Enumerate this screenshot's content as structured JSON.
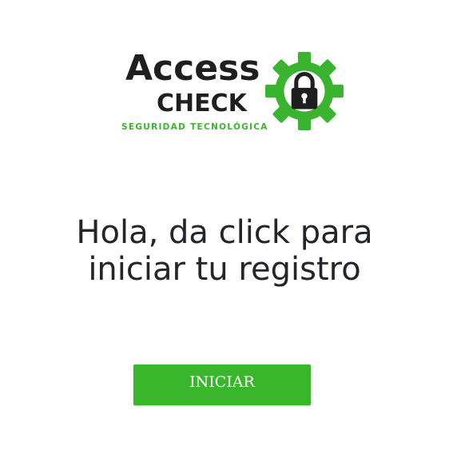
{
  "logo": {
    "title": "Access",
    "subtitle": "CHECK",
    "tagline": "SEGURIDAD TECNOLÓGICA",
    "icon": "gear-lock-icon",
    "colors": {
      "text": "#1f1f1f",
      "accent": "#3ab32f"
    }
  },
  "main": {
    "heading_line1": "Hola, da click para",
    "heading_line2": "iniciar tu registro"
  },
  "actions": {
    "start_label": "INICIAR",
    "start_color": "#3ab62c"
  }
}
